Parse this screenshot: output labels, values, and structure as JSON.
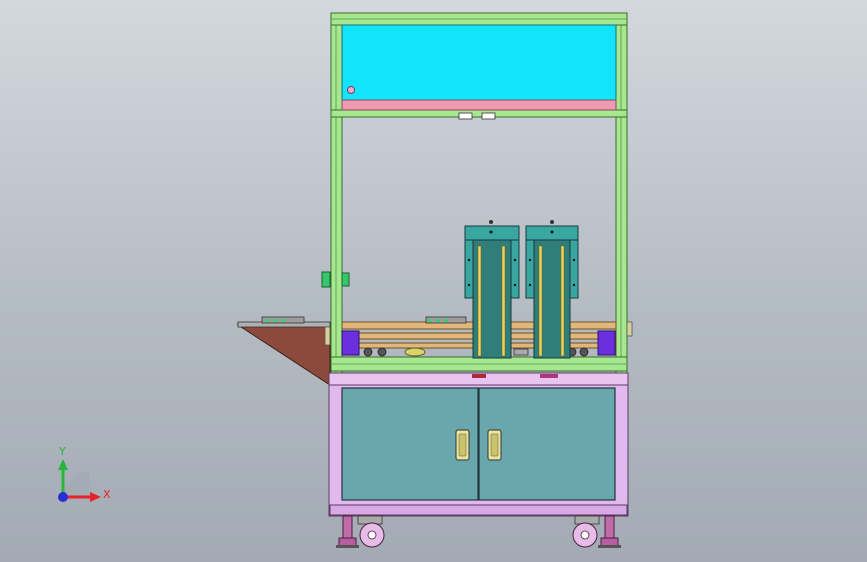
{
  "triad": {
    "x_label": "X",
    "y_label": "Y",
    "x_color": "#e8212b",
    "y_color": "#29b43a",
    "z_color": "#2531d6"
  },
  "colors": {
    "frame": "#a6e88e",
    "frame_edge": "#3c6a2e",
    "top_panel": "#12e4fb",
    "pink_rail": "#ef9ab0",
    "cabinet_frame": "#e3b8ee",
    "cabinet_door": "#6aa7ac",
    "tray": "#8b4a3c",
    "module": "#3aa6a1",
    "conveyor": "#e2b77a"
  }
}
